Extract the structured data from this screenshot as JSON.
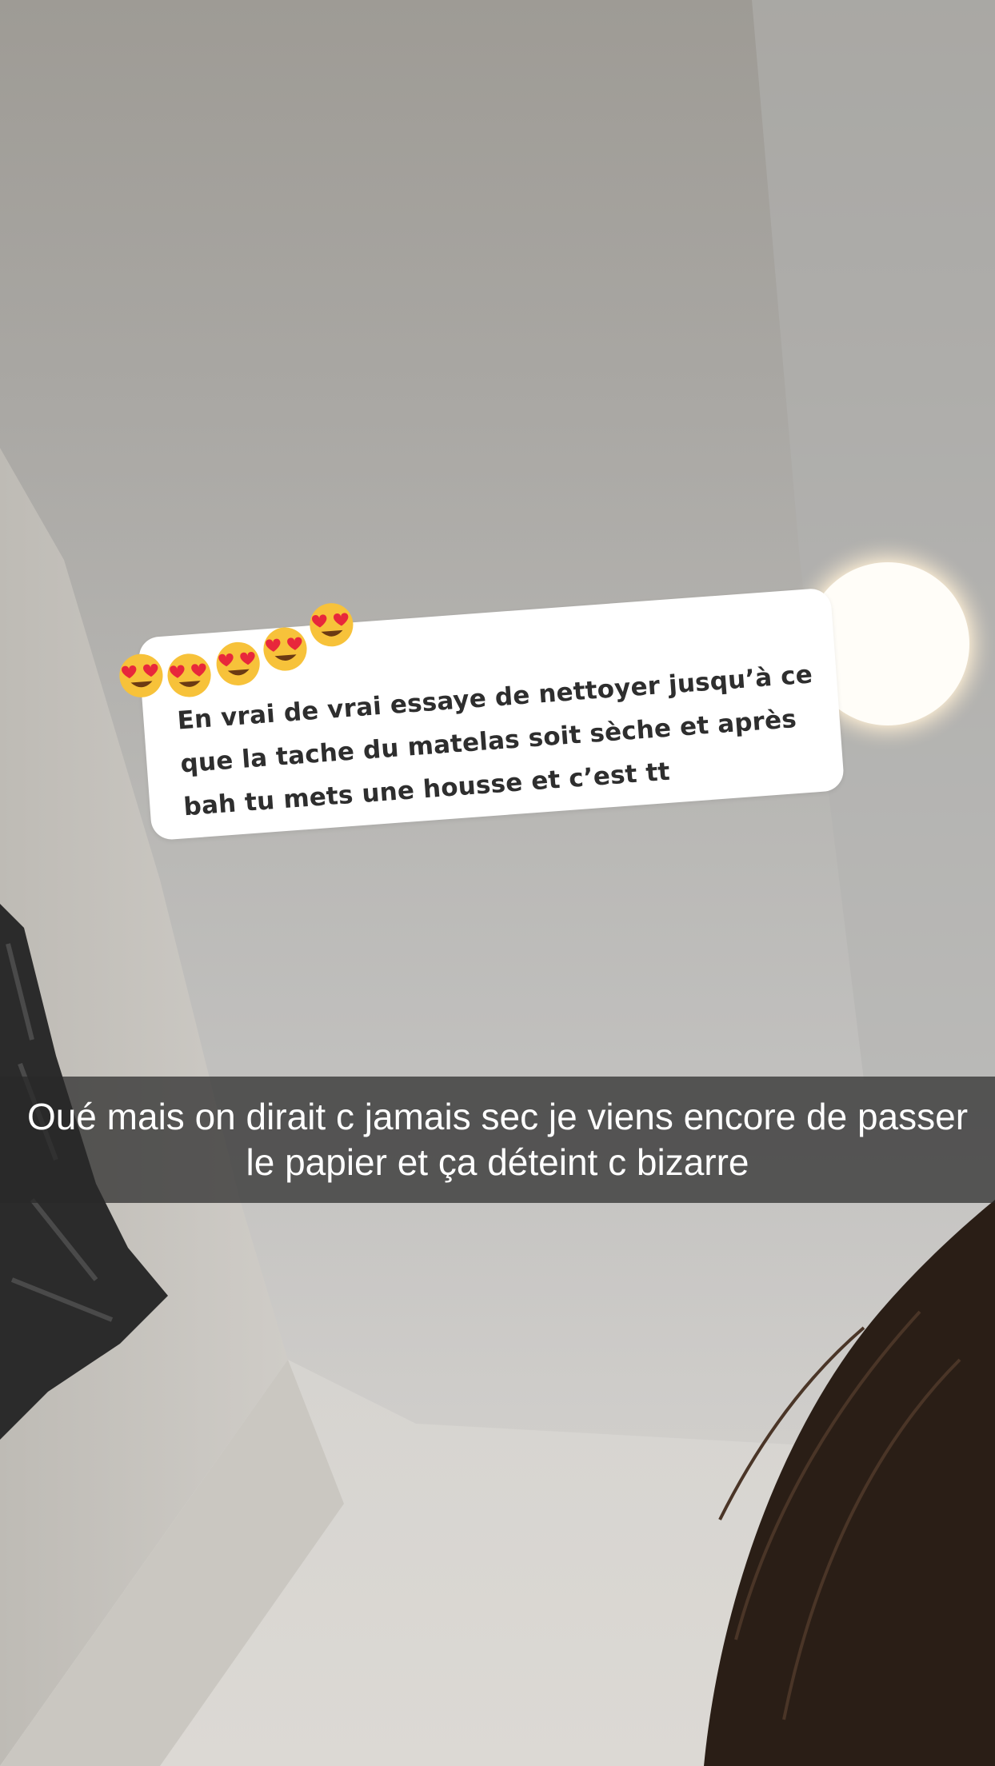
{
  "reply_sticker": {
    "emojis": [
      "heart-eyes-emoji",
      "heart-eyes-emoji",
      "heart-eyes-emoji",
      "heart-eyes-emoji",
      "heart-eyes-emoji"
    ],
    "message": "En vrai de vrai essaye de nettoyer jusqu’à ce que la tache du matelas soit sèche et après bah tu mets une housse et c’est tt"
  },
  "caption": {
    "text": "Oué mais on dirait c jamais sec je viens encore de passer le papier et ça déteint c bizarre"
  }
}
